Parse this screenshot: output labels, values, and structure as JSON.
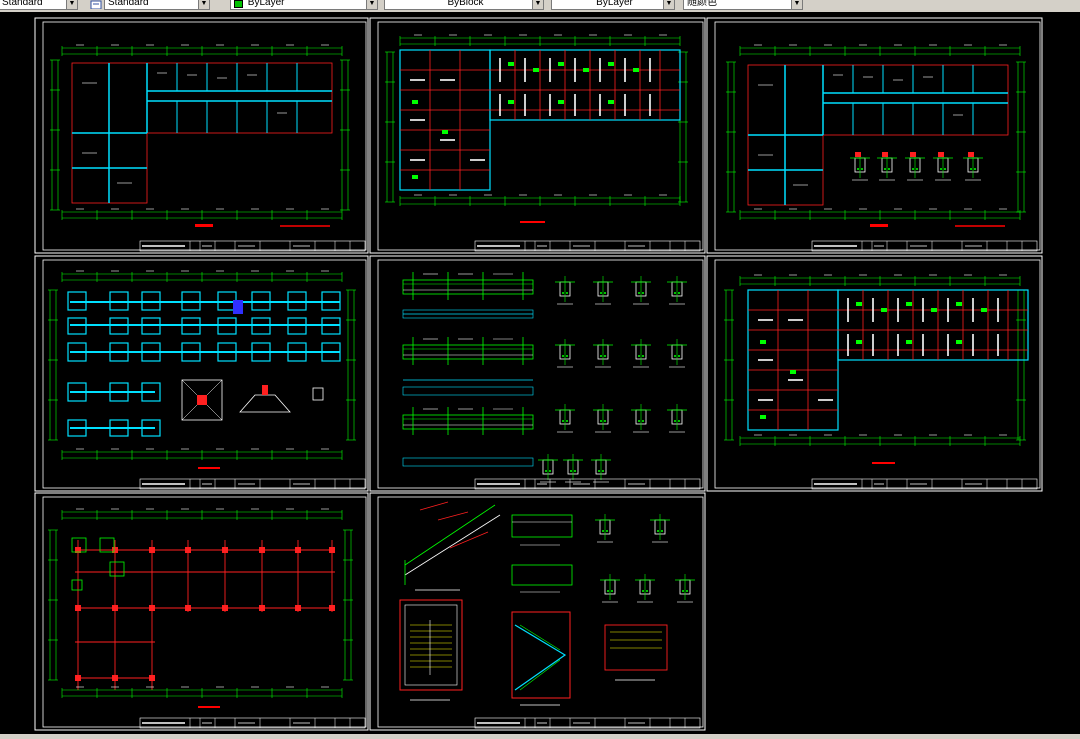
{
  "toolbar": {
    "textstyle": "Standard",
    "dimstyle_left": "Standard",
    "layer_color": "ByLayer",
    "linetype": "ByBlock",
    "lineweight": "ByLayer",
    "plotstyle": "随颜色"
  },
  "colors": {
    "background": "#000000",
    "frame": "#ffffff",
    "axis_green": "#00ff00",
    "wall_cyan": "#00e0ff",
    "grid_red": "#ff2020",
    "title_red": "#ff0000"
  },
  "sheets": [
    {
      "id": "s1",
      "kind": "floor-plan-L"
    },
    {
      "id": "s2",
      "kind": "beam-plan-L"
    },
    {
      "id": "s3",
      "kind": "floor-plan-details"
    },
    {
      "id": "s4",
      "kind": "foundation-plan"
    },
    {
      "id": "s5",
      "kind": "beam-sections"
    },
    {
      "id": "s6",
      "kind": "beam-plan-L-2"
    },
    {
      "id": "s7",
      "kind": "column-grid-plan"
    },
    {
      "id": "s8",
      "kind": "stair-details"
    }
  ]
}
